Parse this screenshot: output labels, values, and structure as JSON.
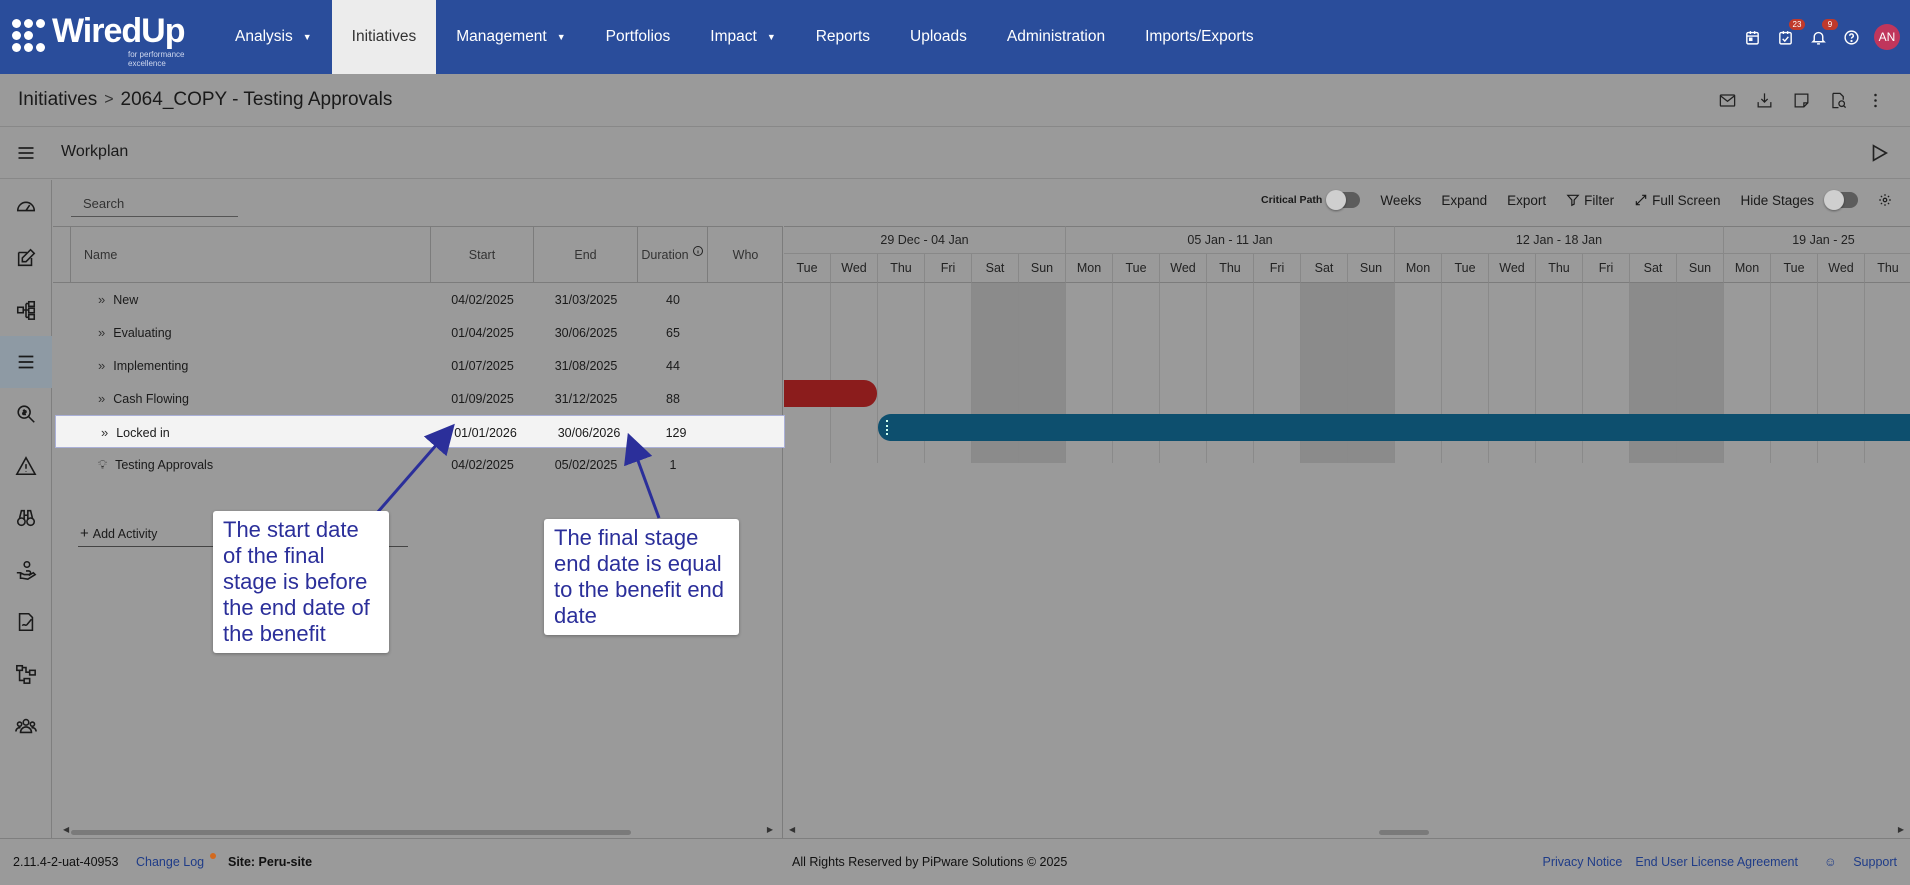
{
  "app": {
    "logo_text": "WiredUp",
    "logo_tagline": "for performance excellence"
  },
  "nav": {
    "items": [
      {
        "label": "Analysis",
        "caret": "▼"
      },
      {
        "label": "Initiatives",
        "caret": ""
      },
      {
        "label": "Management",
        "caret": "▼"
      },
      {
        "label": "Portfolios",
        "caret": ""
      },
      {
        "label": "Impact",
        "caret": "▼"
      },
      {
        "label": "Reports",
        "caret": ""
      },
      {
        "label": "Uploads",
        "caret": ""
      },
      {
        "label": "Administration",
        "caret": ""
      },
      {
        "label": "Imports/Exports",
        "caret": ""
      }
    ],
    "active": "Initiatives",
    "tasks_badge": "23",
    "notifications_badge": "9",
    "avatar_initials": "AN"
  },
  "breadcrumb": {
    "root": "Initiatives",
    "separator": ">",
    "current": "2064_COPY - Testing Approvals"
  },
  "workplan": {
    "title": "Workplan"
  },
  "toolbar": {
    "search_placeholder": "Search",
    "critical_path": "Critical Path",
    "weeks": "Weeks",
    "expand": "Expand",
    "export": "Export",
    "filter": "Filter",
    "full_screen": "Full Screen",
    "hide_stages": "Hide Stages"
  },
  "grid": {
    "headers": {
      "name": "Name",
      "start": "Start",
      "end": "End",
      "duration": "Duration",
      "who": "Who"
    },
    "rows": [
      {
        "name": "New",
        "start": "04/02/2025",
        "end": "31/03/2025",
        "duration": "40",
        "icon": "double-chevron-icon"
      },
      {
        "name": "Evaluating",
        "start": "01/04/2025",
        "end": "30/06/2025",
        "duration": "65",
        "icon": "double-chevron-icon"
      },
      {
        "name": "Implementing",
        "start": "01/07/2025",
        "end": "31/08/2025",
        "duration": "44",
        "icon": "double-chevron-icon"
      },
      {
        "name": "Cash Flowing",
        "start": "01/09/2025",
        "end": "31/12/2025",
        "duration": "88",
        "icon": "double-chevron-icon"
      },
      {
        "name": "Locked in",
        "start": "01/01/2026",
        "end": "30/06/2026",
        "duration": "129",
        "icon": "double-chevron-icon"
      },
      {
        "name": "Testing Approvals",
        "start": "04/02/2025",
        "end": "05/02/2025",
        "duration": "1",
        "icon": "lightbulb-icon"
      }
    ],
    "add_activity": "Add Activity"
  },
  "gantt": {
    "weeks": [
      "29 Dec - 04 Jan",
      "05 Jan - 11 Jan",
      "12 Jan - 18 Jan",
      "19 Jan - 25"
    ],
    "days": [
      "Tue",
      "Wed",
      "Thu",
      "Fri",
      "Sat",
      "Sun",
      "Mon",
      "Tue",
      "Wed",
      "Thu",
      "Fri",
      "Sat",
      "Sun",
      "Mon",
      "Tue",
      "Wed",
      "Thu",
      "Fri",
      "Sat",
      "Sun",
      "Mon",
      "Tue",
      "Wed",
      "Thu"
    ],
    "weekend_days": [
      "Sat",
      "Sun"
    ],
    "bar_colors": {
      "cash_flowing": "#8b1c1c",
      "locked_in": "#0d4f6e"
    }
  },
  "callouts": {
    "left": "The start date of the final stage is before the end date of the benefit",
    "right": "The final stage end date is equal to the benefit end date",
    "color": "#2b2f9a"
  },
  "footer": {
    "version": "2.11.4-2-uat-40953",
    "change_log": "Change Log",
    "site": "Site: Peru-site",
    "copyright": "All Rights Reserved by PiPware Solutions © 2025",
    "privacy": "Privacy Notice",
    "eula": "End User License Agreement",
    "support": "Support"
  },
  "colors": {
    "header_bg": "#2a4d9b",
    "overlay_bg": "#9a9a9a",
    "link": "#1f3c88"
  }
}
